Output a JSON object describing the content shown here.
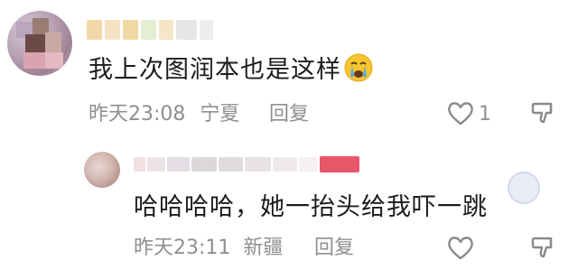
{
  "comments": [
    {
      "text": "我上次图润本也是这样",
      "emoji": "crying-face-emoji",
      "time": "昨天23:08",
      "location": "宁夏",
      "reply_label": "回复",
      "like_count": "1"
    },
    {
      "text": "哈哈哈哈，她一抬头给我吓一跳",
      "time": "昨天23:11",
      "location": "新疆",
      "reply_label": "回复"
    }
  ],
  "colors": {
    "text": "#1c1c1c",
    "meta": "#8f8f8f",
    "icon": "#8a8a8a",
    "author_badge": "#e8566a"
  },
  "icons": [
    "thumbs-up-outline",
    "thumbs-down-outline",
    "crying-face-emoji"
  ]
}
